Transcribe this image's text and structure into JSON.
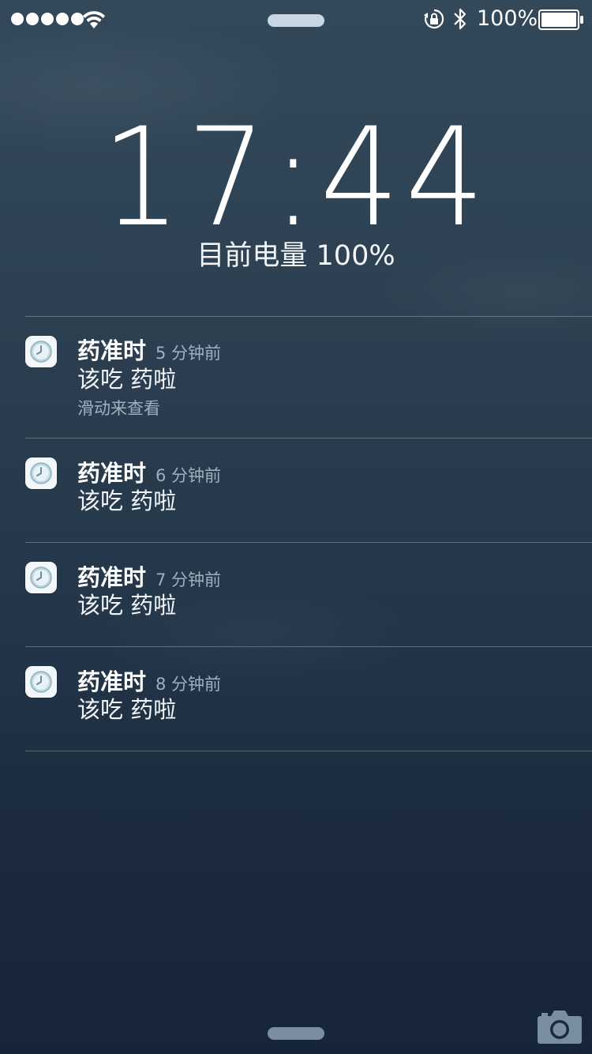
{
  "status_bar": {
    "signal_dots": 5,
    "battery_percent": "100%",
    "icons": [
      "signal-dots",
      "wifi-icon",
      "rotation-lock-icon",
      "bluetooth-icon",
      "battery-icon"
    ]
  },
  "lock_screen": {
    "time": "17:44",
    "charge_status": "目前电量 100%"
  },
  "notifications": [
    {
      "app": "药准时",
      "time": "5 分钟前",
      "message": "该吃 药啦",
      "hint": "滑动来查看"
    },
    {
      "app": "药准时",
      "time": "6 分钟前",
      "message": "该吃 药啦"
    },
    {
      "app": "药准时",
      "time": "7 分钟前",
      "message": "该吃 药啦"
    },
    {
      "app": "药准时",
      "time": "8 分钟前",
      "message": "该吃 药啦"
    }
  ],
  "colors": {
    "background_top": "#33495a",
    "background_bottom": "#17253a",
    "secondary_text": "#9fb0c0"
  }
}
